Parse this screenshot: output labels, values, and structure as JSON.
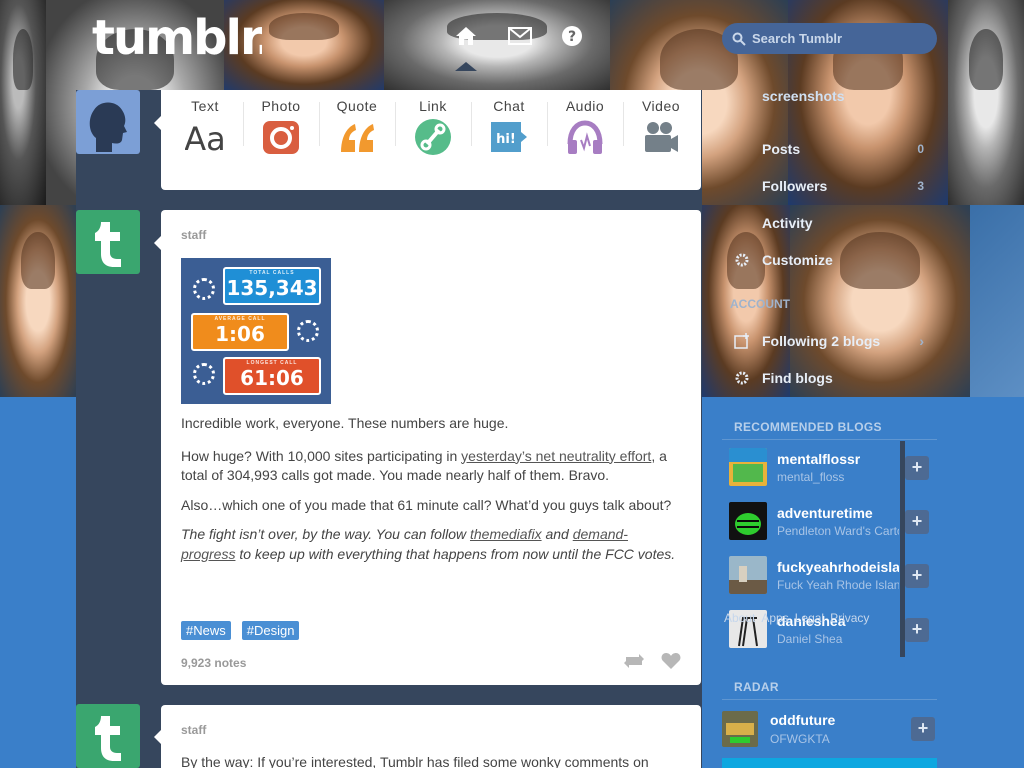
{
  "header": {
    "logo_text": "tumblr.",
    "search_placeholder": "Search Tumblr",
    "icons": [
      "home-icon",
      "mail-icon",
      "help-icon"
    ]
  },
  "post_form": {
    "items": [
      {
        "label": "Text",
        "icon": "text-icon",
        "color": "#444444"
      },
      {
        "label": "Photo",
        "icon": "camera-icon",
        "color": "#d95e40"
      },
      {
        "label": "Quote",
        "icon": "quote-icon",
        "color": "#f2992e"
      },
      {
        "label": "Link",
        "icon": "link-icon",
        "color": "#56bc8a"
      },
      {
        "label": "Chat",
        "icon": "chat-icon",
        "color": "#529ecc"
      },
      {
        "label": "Audio",
        "icon": "headphones-icon",
        "color": "#a77dc2"
      },
      {
        "label": "Video",
        "icon": "video-camera-icon",
        "color": "#748089"
      }
    ]
  },
  "posts": [
    {
      "blog": "staff",
      "image_stats": [
        {
          "caption": "TOTAL CALLS",
          "value": "135,343",
          "color": "#1f8fd6"
        },
        {
          "caption": "AVERAGE CALL",
          "value": "1:06",
          "color": "#f08c1c"
        },
        {
          "caption": "LONGEST CALL",
          "value": "61:06",
          "color": "#e0502a"
        }
      ],
      "p1": "Incredible work, everyone. These numbers are huge.",
      "p2_before": "How huge? With 10,000 sites participating in ",
      "p2_link": "yesterday’s net neutrality effort",
      "p2_after": ", a total of 304,993 calls got made. You made nearly half of them. Bravo.",
      "p3": "Also…which one of you made that 61 minute call? What’d you guys talk about?",
      "p4_before": "The fight isn’t over, by the way. You can follow ",
      "p4_link1": "themediafix",
      "p4_mid": " and ",
      "p4_link2": "demand-progress",
      "p4_after": " to keep up with everything that happens from now until the FCC votes.",
      "tags": [
        "#News",
        "#Design"
      ],
      "notes": "9,923 notes"
    },
    {
      "blog": "staff",
      "text": "By the way: If you’re interested, Tumblr has filed some wonky comments on"
    }
  ],
  "sidebar": {
    "menu": [
      {
        "label": "screenshots",
        "icon": "blog-icon",
        "count": ""
      },
      {
        "label": "Posts",
        "icon": "posts-icon",
        "count": "0"
      },
      {
        "label": "Followers",
        "icon": "followers-icon",
        "count": "3"
      },
      {
        "label": "Activity",
        "icon": "activity-icon",
        "count": ""
      },
      {
        "label": "Customize",
        "icon": "gear-icon",
        "count": ""
      },
      {
        "label": "ACCOUNT",
        "icon": "",
        "count": ""
      },
      {
        "label": "Following 2 blogs",
        "icon": "following-icon",
        "count": ""
      },
      {
        "label": "Find blogs",
        "icon": "find-blogs-icon",
        "count": ""
      }
    ],
    "recommended_title": "RECOMMENDED BLOGS",
    "recommended": [
      {
        "name": "mentalflossr",
        "sub": "mental_floss",
        "color": "#e8b23a"
      },
      {
        "name": "adventuretime",
        "sub": "Pendleton Ward's Cartoon",
        "color": "#2ecc2e"
      },
      {
        "name": "fuckyeahrhodeisland",
        "sub": "Fuck Yeah Rhode Island",
        "color": "#9ab7c9"
      },
      {
        "name": "danieshea",
        "sub": "Daniel Shea",
        "color": "#cfcfcf"
      }
    ],
    "footer_links": [
      "About",
      "Apps",
      "Legal",
      "Privacy"
    ],
    "radar_title": "RADAR",
    "radar": {
      "name": "oddfuture",
      "sub": "OFWGKTA"
    }
  }
}
